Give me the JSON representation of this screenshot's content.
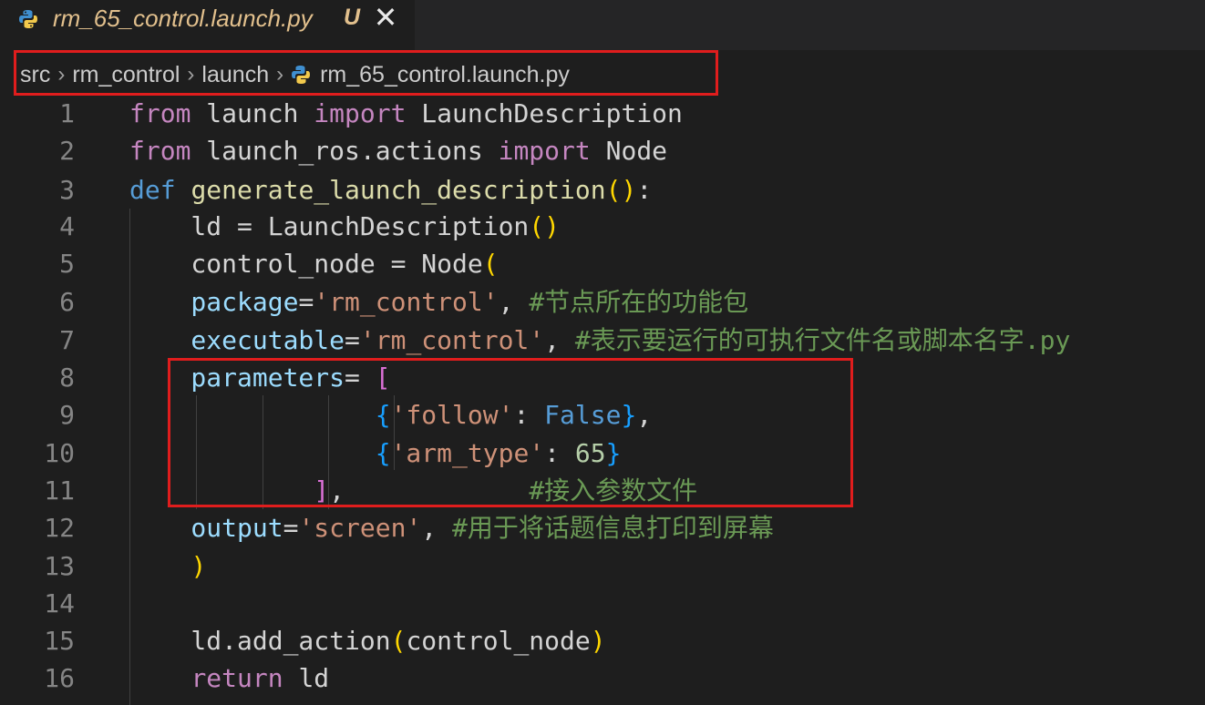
{
  "tab": {
    "icon": "python-icon",
    "filename": "rm_65_control.launch.py",
    "status": "U",
    "close": "✕"
  },
  "breadcrumb": {
    "items": [
      "src",
      "rm_control",
      "launch",
      "rm_65_control.launch.py"
    ],
    "separator": "›"
  },
  "colors": {
    "keyword_control": "#c586c0",
    "keyword": "#569cd6",
    "function": "#dcdcaa",
    "class": "#4ec9b0",
    "variable": "#9cdcfe",
    "string": "#ce9178",
    "number": "#b5cea8",
    "comment": "#6a9955",
    "bracket1": "#ffd700",
    "bracket2": "#da70d6",
    "bracket3": "#179fff",
    "plain": "#d4d4d4",
    "highlight": "#e01d1d"
  },
  "code_lines": [
    {
      "n": "1",
      "tokens": [
        [
          "from",
          "#c586c0"
        ],
        [
          " launch ",
          "#d4d4d4"
        ],
        [
          "import",
          "#c586c0"
        ],
        [
          " LaunchDescription",
          "#d4d4d4"
        ]
      ]
    },
    {
      "n": "2",
      "tokens": [
        [
          "from",
          "#c586c0"
        ],
        [
          " launch_ros.actions ",
          "#d4d4d4"
        ],
        [
          "import",
          "#c586c0"
        ],
        [
          " Node",
          "#d4d4d4"
        ]
      ]
    },
    {
      "n": "3",
      "tokens": [
        [
          "def",
          "#569cd6"
        ],
        [
          " ",
          "#d4d4d4"
        ],
        [
          "generate_launch_description",
          "#dcdcaa"
        ],
        [
          "()",
          "#ffd700"
        ],
        [
          ":",
          "#d4d4d4"
        ]
      ]
    },
    {
      "n": "4",
      "tokens": [
        [
          "    ld = LaunchDescription",
          "#d4d4d4"
        ],
        [
          "()",
          "#ffd700"
        ]
      ]
    },
    {
      "n": "5",
      "tokens": [
        [
          "    control_node = Node",
          "#d4d4d4"
        ],
        [
          "(",
          "#ffd700"
        ]
      ]
    },
    {
      "n": "6",
      "tokens": [
        [
          "    package",
          "#9cdcfe"
        ],
        [
          "=",
          "#d4d4d4"
        ],
        [
          "'rm_control'",
          "#ce9178"
        ],
        [
          ", ",
          "#d4d4d4"
        ],
        [
          "#节点所在的功能包",
          "#6a9955"
        ]
      ]
    },
    {
      "n": "7",
      "tokens": [
        [
          "    executable",
          "#9cdcfe"
        ],
        [
          "=",
          "#d4d4d4"
        ],
        [
          "'rm_control'",
          "#ce9178"
        ],
        [
          ", ",
          "#d4d4d4"
        ],
        [
          "#表示要运行的可执行文件名或脚本名字.py",
          "#6a9955"
        ]
      ]
    },
    {
      "n": "8",
      "tokens": [
        [
          "    parameters",
          "#9cdcfe"
        ],
        [
          "= ",
          "#d4d4d4"
        ],
        [
          "[",
          "#da70d6"
        ]
      ]
    },
    {
      "n": "9",
      "tokens": [
        [
          "                ",
          "#d4d4d4"
        ],
        [
          "{",
          "#179fff"
        ],
        [
          "'follow'",
          "#ce9178"
        ],
        [
          ": ",
          "#d4d4d4"
        ],
        [
          "False",
          "#569cd6"
        ],
        [
          "}",
          "#179fff"
        ],
        [
          ",",
          "#d4d4d4"
        ]
      ]
    },
    {
      "n": "10",
      "tokens": [
        [
          "                ",
          "#d4d4d4"
        ],
        [
          "{",
          "#179fff"
        ],
        [
          "'arm_type'",
          "#ce9178"
        ],
        [
          ": ",
          "#d4d4d4"
        ],
        [
          "65",
          "#b5cea8"
        ],
        [
          "}",
          "#179fff"
        ]
      ]
    },
    {
      "n": "11",
      "tokens": [
        [
          "            ",
          "#d4d4d4"
        ],
        [
          "]",
          "#da70d6"
        ],
        [
          ",            ",
          "#d4d4d4"
        ],
        [
          "#接入参数文件",
          "#6a9955"
        ]
      ]
    },
    {
      "n": "12",
      "tokens": [
        [
          "    output",
          "#9cdcfe"
        ],
        [
          "=",
          "#d4d4d4"
        ],
        [
          "'screen'",
          "#ce9178"
        ],
        [
          ", ",
          "#d4d4d4"
        ],
        [
          "#用于将话题信息打印到屏幕",
          "#6a9955"
        ]
      ]
    },
    {
      "n": "13",
      "tokens": [
        [
          "    ",
          "#d4d4d4"
        ],
        [
          ")",
          "#ffd700"
        ]
      ]
    },
    {
      "n": "14",
      "tokens": [
        [
          "",
          "#d4d4d4"
        ]
      ]
    },
    {
      "n": "15",
      "tokens": [
        [
          "    ld.add_action",
          "#d4d4d4"
        ],
        [
          "(",
          "#ffd700"
        ],
        [
          "control_node",
          "#d4d4d4"
        ],
        [
          ")",
          "#ffd700"
        ]
      ]
    },
    {
      "n": "16",
      "tokens": [
        [
          "    ",
          "#d4d4d4"
        ],
        [
          "return",
          "#c586c0"
        ],
        [
          " ld",
          "#d4d4d4"
        ]
      ]
    }
  ]
}
